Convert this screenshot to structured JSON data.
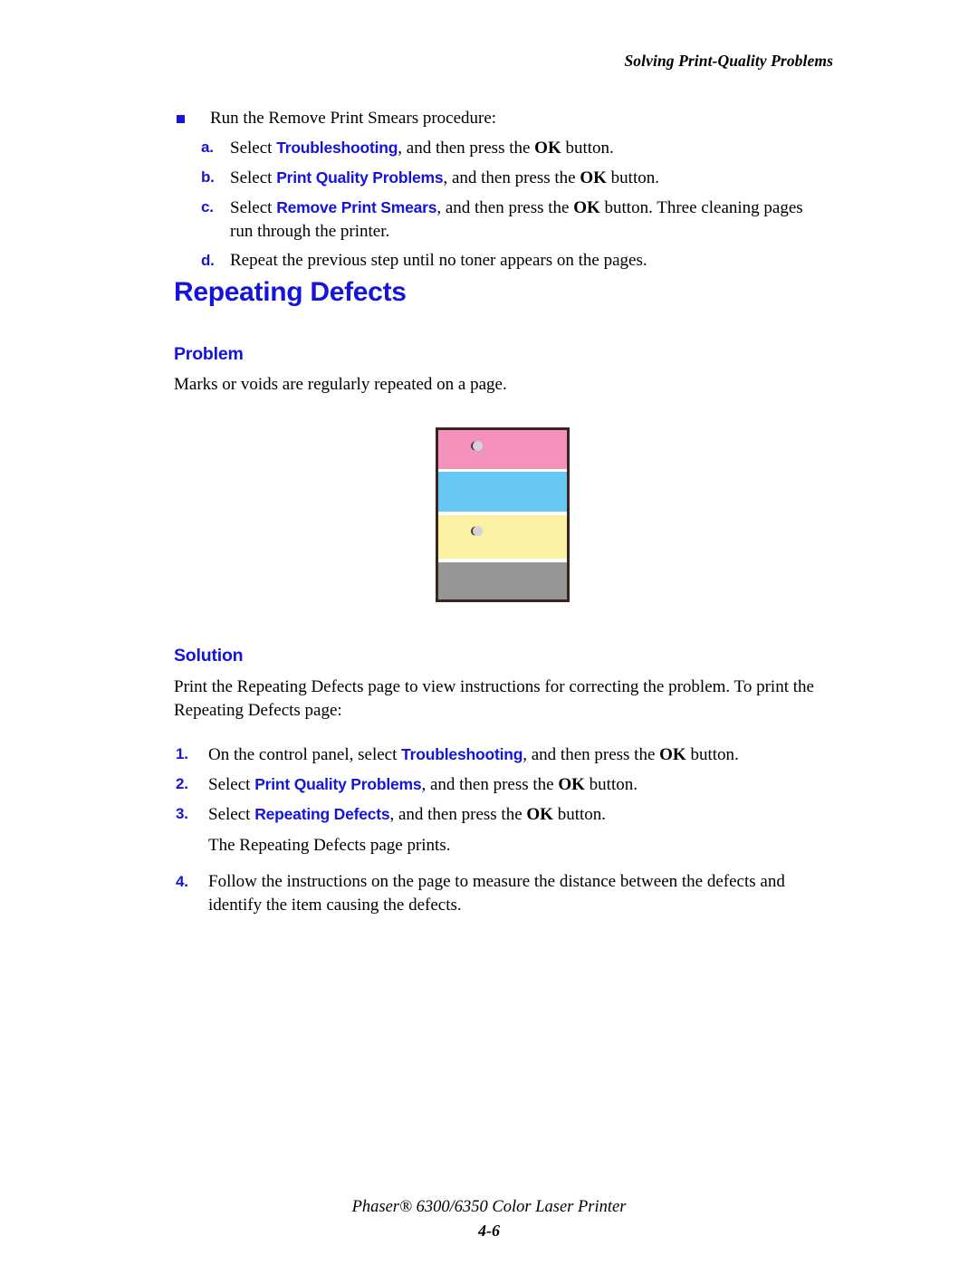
{
  "header": {
    "running_title": "Solving Print-Quality Problems"
  },
  "top_procedure": {
    "bullet_text": "Run the Remove Print Smears procedure:",
    "steps": [
      {
        "label": "a.",
        "pre": "Select ",
        "term": "Troubleshooting",
        "mid": ", and then press the ",
        "key": "OK",
        "post": " button.",
        "cont": ""
      },
      {
        "label": "b.",
        "pre": "Select ",
        "term": "Print Quality Problems",
        "mid": ", and then press the ",
        "key": "OK",
        "post": " button.",
        "cont": ""
      },
      {
        "label": "c.",
        "pre": "Select ",
        "term": "Remove Print Smears",
        "mid": ", and then press the ",
        "key": "OK",
        "post": " button. Three cleaning pages",
        "cont": "run through the printer."
      },
      {
        "label": "d.",
        "pre": "Repeat the previous step until no toner appears on the pages.",
        "term": "",
        "mid": "",
        "key": "",
        "post": "",
        "cont": ""
      }
    ]
  },
  "section": {
    "title": "Repeating Defects",
    "problem_heading": "Problem",
    "problem_text": "Marks or voids are regularly repeated on a page.",
    "solution_heading": "Solution",
    "solution_intro": "Print the Repeating Defects page to view instructions for correcting the problem. To print the Repeating Defects page:",
    "solution_steps": [
      {
        "label": "1.",
        "pre": "On the control panel, select ",
        "term": "Troubleshooting",
        "mid": ", and then press the ",
        "key": "OK",
        "post": " button.",
        "cont": ""
      },
      {
        "label": "2.",
        "pre": "Select ",
        "term": "Print Quality Problems",
        "mid": ", and then press the ",
        "key": "OK",
        "post": " button.",
        "cont": ""
      },
      {
        "label": "3.",
        "pre": "Select ",
        "term": "Repeating Defects",
        "mid": ", and then press the ",
        "key": "OK",
        "post": " button.",
        "cont": ""
      }
    ],
    "solution_note": "The Repeating Defects page prints.",
    "solution_step_4": {
      "label": "4.",
      "pre": "Follow the instructions on the page to measure the distance between the defects and identify the item causing the defects.",
      "term": "",
      "mid": "",
      "key": "",
      "post": "",
      "cont": ""
    }
  },
  "figure": {
    "caption": "",
    "bands": [
      {
        "name": "magenta-band",
        "color": "#f491bd"
      },
      {
        "name": "cyan-band",
        "color": "#66c7f4"
      },
      {
        "name": "yellow-band",
        "color": "#faf1a2"
      },
      {
        "name": "gray-band",
        "color": "#969696"
      }
    ],
    "defect_count": 2
  },
  "footer": {
    "product": "Phaser® 6300/6350 Color Laser Printer",
    "page_number": "4-6"
  },
  "colors": {
    "accent_blue": "#1414dc",
    "text_black": "#000000",
    "figure_border": "#3a2420"
  }
}
